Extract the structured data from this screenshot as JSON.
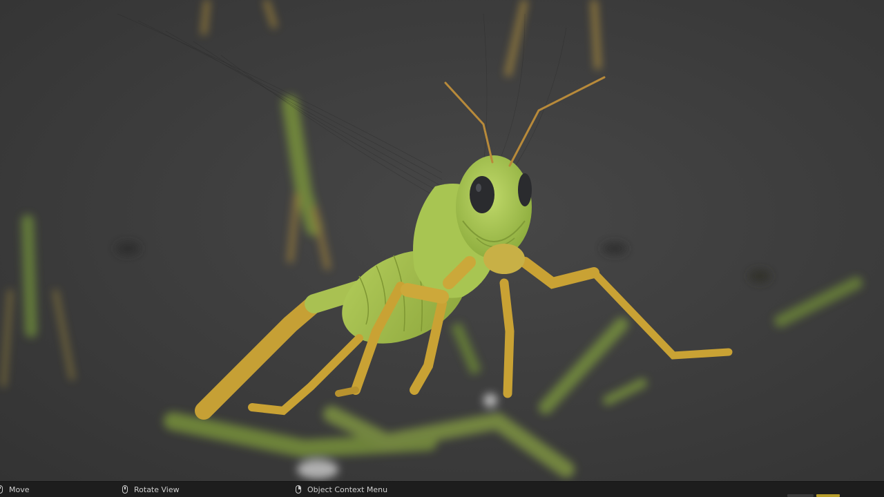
{
  "statusbar": {
    "hints": [
      {
        "icon": "mouse-left-icon",
        "label": "Move"
      },
      {
        "icon": "mouse-middle-icon",
        "label": "Rotate View"
      },
      {
        "icon": "mouse-right-icon",
        "label": "Object Context Menu"
      }
    ]
  },
  "colors": {
    "body_green": "#a6c44f",
    "leg_yellow": "#c9a234",
    "eye_dark": "#2a2b2e",
    "accent_yellow": "#b79d2b"
  }
}
